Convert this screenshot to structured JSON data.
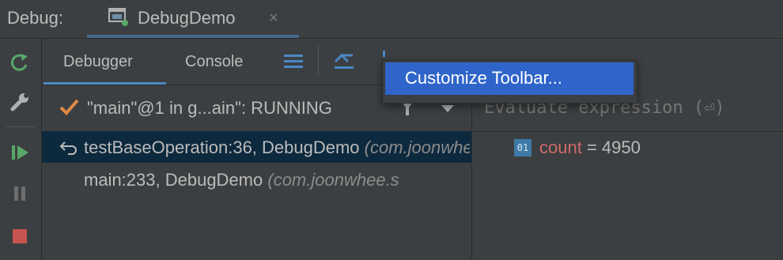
{
  "debug_label": "Debug:",
  "run_tab": {
    "title": "DebugDemo",
    "close_glyph": "×",
    "icon": "window-icon"
  },
  "left_toolbar": [
    {
      "name": "rerun-icon",
      "color": "#59a869"
    },
    {
      "name": "wrench-icon",
      "color": "#afb1b3"
    },
    {
      "name": "resume-icon",
      "color": "#59a869"
    },
    {
      "name": "pause-icon",
      "color": "#6e6e6e"
    },
    {
      "name": "stop-icon",
      "color": "#c75450"
    }
  ],
  "tabs": {
    "debugger": "Debugger",
    "console": "Console"
  },
  "toolbar_icons": [
    "layout-menu-icon",
    "show-execution-point-icon",
    "step-over-icon"
  ],
  "popup": {
    "item_label": "Customize Toolbar..."
  },
  "thread": {
    "label": "\"main\"@1 in g...ain\": RUNNING",
    "status_icon": "check-icon"
  },
  "frames": [
    {
      "method": "testBaseOperation:36, DebugDemo",
      "package": "(com.joonwhee.s",
      "selected": true,
      "icon": "return-arrow-icon"
    },
    {
      "method": "main:233, DebugDemo",
      "package": "(com.joonwhee.s",
      "selected": false
    }
  ],
  "evaluate": {
    "placeholder": "Evaluate expression (⏎)"
  },
  "variables": [
    {
      "icon_text": "01",
      "name": "count",
      "eq": " = ",
      "value": "4950"
    }
  ],
  "colors": {
    "accent": "#4a88c7",
    "selection": "#2f65ca",
    "frame_selected": "#0d293e",
    "var_name": "#cf6a6a"
  }
}
